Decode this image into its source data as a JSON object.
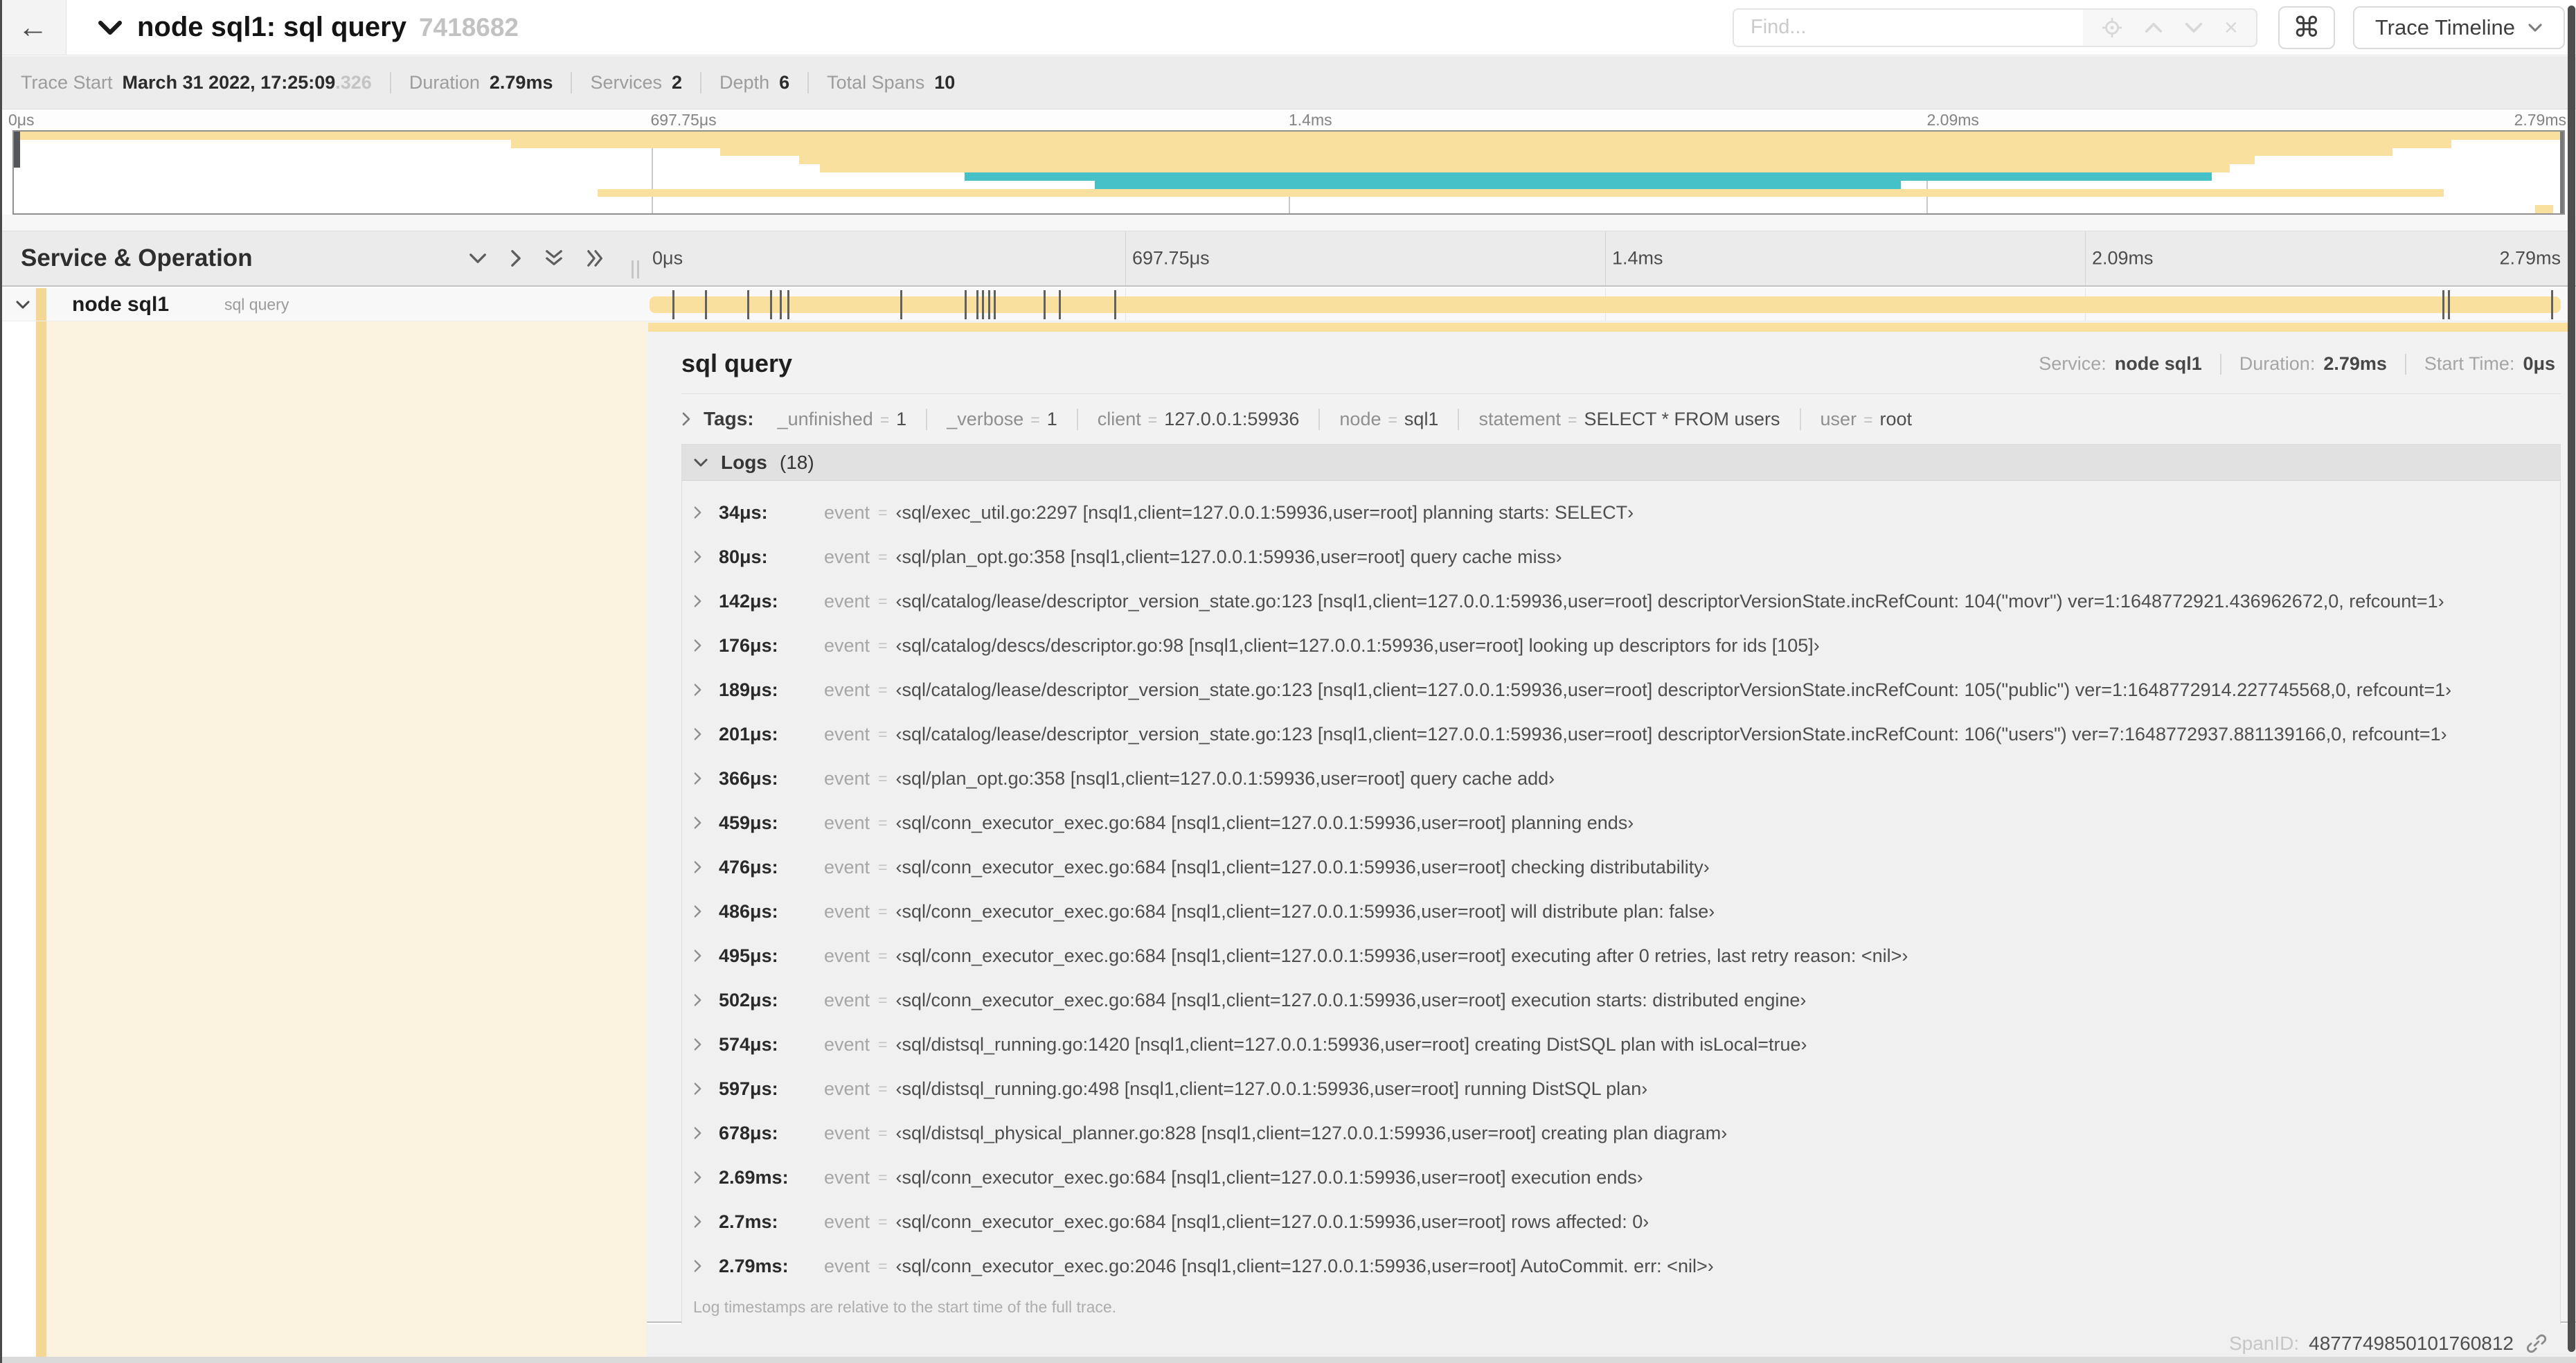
{
  "header": {
    "back_label": "←",
    "title": "node sql1: sql query",
    "trace_id": "7418682",
    "find_placeholder": "Find...",
    "shortcut_button": "⌘",
    "view_selector": "Trace Timeline"
  },
  "meta": {
    "items": [
      {
        "label": "Trace Start",
        "value": "March 31 2022, 17:25:09",
        "suffix": ".326"
      },
      {
        "label": "Duration",
        "value": "2.79ms"
      },
      {
        "label": "Services",
        "value": "2"
      },
      {
        "label": "Depth",
        "value": "6"
      },
      {
        "label": "Total Spans",
        "value": "10"
      }
    ]
  },
  "minimap": {
    "tick_labels": [
      "0μs",
      "697.75μs",
      "1.4ms",
      "2.09ms",
      "2.79ms"
    ],
    "spans": [
      {
        "row": 0,
        "start_pct": 0,
        "end_pct": 100,
        "color": "tan"
      },
      {
        "row": 1,
        "start_pct": 19.5,
        "end_pct": 95.6,
        "color": "tan"
      },
      {
        "row": 2,
        "start_pct": 27.7,
        "end_pct": 93.3,
        "color": "tan"
      },
      {
        "row": 3,
        "start_pct": 30.8,
        "end_pct": 87.9,
        "color": "tan"
      },
      {
        "row": 4,
        "start_pct": 31.6,
        "end_pct": 86.9,
        "color": "tan"
      },
      {
        "row": 5,
        "start_pct": 37.3,
        "end_pct": 86.2,
        "color": "teal"
      },
      {
        "row": 6,
        "start_pct": 42.4,
        "end_pct": 74.0,
        "color": "teal"
      },
      {
        "row": 7,
        "start_pct": 22.9,
        "end_pct": 95.3,
        "color": "tan"
      },
      {
        "row": 9,
        "start_pct": 98.9,
        "end_pct": 99.6,
        "color": "tan"
      }
    ]
  },
  "timeline": {
    "column_title": "Service & Operation",
    "ticks": [
      "0μs",
      "697.75μs",
      "1.4ms",
      "2.09ms",
      "2.79ms"
    ]
  },
  "span_row": {
    "service": "node sql1",
    "operation": "sql query",
    "marker_pcts": [
      1.2,
      2.9,
      5.1,
      6.3,
      6.8,
      7.2,
      13.1,
      16.5,
      17.1,
      17.4,
      17.7,
      18.0,
      20.6,
      21.4,
      24.3,
      93.8,
      94.1,
      99.5
    ]
  },
  "detail": {
    "operation": "sql query",
    "service_label": "Service:",
    "service": "node sql1",
    "duration_label": "Duration:",
    "duration": "2.79ms",
    "start_label": "Start Time:",
    "start_time": "0μs",
    "tags_label": "Tags:",
    "tags": [
      {
        "key": "_unfinished",
        "value": "1"
      },
      {
        "key": "_verbose",
        "value": "1"
      },
      {
        "key": "client",
        "value": "127.0.0.1:59936"
      },
      {
        "key": "node",
        "value": "sql1"
      },
      {
        "key": "statement",
        "value": "SELECT * FROM users"
      },
      {
        "key": "user",
        "value": "root"
      }
    ],
    "logs_label": "Logs",
    "logs_count": "(18)",
    "logs": [
      {
        "time": "34μs",
        "field": "event",
        "value": "‹sql/exec_util.go:2297 [nsql1,client=127.0.0.1:59936,user=root] planning starts: SELECT›"
      },
      {
        "time": "80μs",
        "field": "event",
        "value": "‹sql/plan_opt.go:358 [nsql1,client=127.0.0.1:59936,user=root] query cache miss›"
      },
      {
        "time": "142μs",
        "field": "event",
        "value": "‹sql/catalog/lease/descriptor_version_state.go:123 [nsql1,client=127.0.0.1:59936,user=root] descriptorVersionState.incRefCount: 104(\"movr\") ver=1:1648772921.436962672,0, refcount=1›"
      },
      {
        "time": "176μs",
        "field": "event",
        "value": "‹sql/catalog/descs/descriptor.go:98 [nsql1,client=127.0.0.1:59936,user=root] looking up descriptors for ids [105]›"
      },
      {
        "time": "189μs",
        "field": "event",
        "value": "‹sql/catalog/lease/descriptor_version_state.go:123 [nsql1,client=127.0.0.1:59936,user=root] descriptorVersionState.incRefCount: 105(\"public\") ver=1:1648772914.227745568,0, refcount=1›"
      },
      {
        "time": "201μs",
        "field": "event",
        "value": "‹sql/catalog/lease/descriptor_version_state.go:123 [nsql1,client=127.0.0.1:59936,user=root] descriptorVersionState.incRefCount: 106(\"users\") ver=7:1648772937.881139166,0, refcount=1›"
      },
      {
        "time": "366μs",
        "field": "event",
        "value": "‹sql/plan_opt.go:358 [nsql1,client=127.0.0.1:59936,user=root] query cache add›"
      },
      {
        "time": "459μs",
        "field": "event",
        "value": "‹sql/conn_executor_exec.go:684 [nsql1,client=127.0.0.1:59936,user=root] planning ends›"
      },
      {
        "time": "476μs",
        "field": "event",
        "value": "‹sql/conn_executor_exec.go:684 [nsql1,client=127.0.0.1:59936,user=root] checking distributability›"
      },
      {
        "time": "486μs",
        "field": "event",
        "value": "‹sql/conn_executor_exec.go:684 [nsql1,client=127.0.0.1:59936,user=root] will distribute plan: false›"
      },
      {
        "time": "495μs",
        "field": "event",
        "value": "‹sql/conn_executor_exec.go:684 [nsql1,client=127.0.0.1:59936,user=root] executing after 0 retries, last retry reason: <nil>›"
      },
      {
        "time": "502μs",
        "field": "event",
        "value": "‹sql/conn_executor_exec.go:684 [nsql1,client=127.0.0.1:59936,user=root] execution starts: distributed engine›"
      },
      {
        "time": "574μs",
        "field": "event",
        "value": "‹sql/distsql_running.go:1420 [nsql1,client=127.0.0.1:59936,user=root] creating DistSQL plan with isLocal=true›"
      },
      {
        "time": "597μs",
        "field": "event",
        "value": "‹sql/distsql_running.go:498 [nsql1,client=127.0.0.1:59936,user=root] running DistSQL plan›"
      },
      {
        "time": "678μs",
        "field": "event",
        "value": "‹sql/distsql_physical_planner.go:828 [nsql1,client=127.0.0.1:59936,user=root] creating plan diagram›"
      },
      {
        "time": "2.69ms",
        "field": "event",
        "value": "‹sql/conn_executor_exec.go:684 [nsql1,client=127.0.0.1:59936,user=root] execution ends›"
      },
      {
        "time": "2.7ms",
        "field": "event",
        "value": "‹sql/conn_executor_exec.go:684 [nsql1,client=127.0.0.1:59936,user=root] rows affected: 0›"
      },
      {
        "time": "2.79ms",
        "field": "event",
        "value": "‹sql/conn_executor_exec.go:2046 [nsql1,client=127.0.0.1:59936,user=root] AutoCommit. err: <nil>›"
      }
    ],
    "footer_note": "Log timestamps are relative to the start time of the full trace.",
    "span_id_label": "SpanID:",
    "span_id": "4877749850101760812"
  },
  "colors": {
    "span_tan": "#F9E09E",
    "span_teal": "#45C1C7",
    "accent_strip": "#F3D794",
    "detail_cream": "#FBF3DF"
  }
}
